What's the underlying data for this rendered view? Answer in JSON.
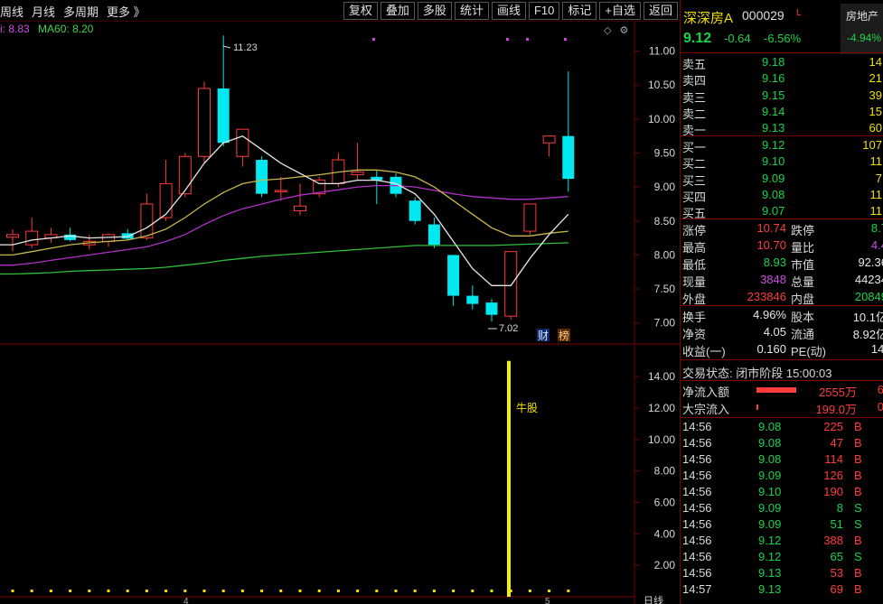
{
  "toolbar": {
    "left_items": [
      "周线",
      "月线",
      "多周期",
      "更多 》"
    ],
    "buttons": [
      "复权",
      "叠加",
      "多股",
      "统计",
      "画线",
      "F10",
      "标记",
      "+自选",
      "返回"
    ]
  },
  "ma_legend": {
    "ma_partial": "i: 8.83",
    "ma60": "MA60: 8.20"
  },
  "chart_labels": {
    "high": "11.23",
    "low": "7.02",
    "badge_cai": "财",
    "badge_bang": "榜",
    "vol_marker": "牛股",
    "x_tick_1": "4",
    "x_tick_2": "5",
    "period_label": "日线"
  },
  "price_axis": [
    "11.00",
    "10.50",
    "10.00",
    "9.50",
    "9.00",
    "8.50",
    "8.00",
    "7.50",
    "7.00"
  ],
  "vol_axis": [
    "14.00",
    "12.00",
    "10.00",
    "8.00",
    "6.00",
    "4.00",
    "2.00"
  ],
  "chart_data": {
    "type": "candlestick",
    "ylim": [
      6.85,
      11.3
    ],
    "candles": [
      {
        "o": 8.26,
        "h": 8.38,
        "l": 8.05,
        "c": 8.3
      },
      {
        "o": 8.15,
        "h": 8.55,
        "l": 8.1,
        "c": 8.35
      },
      {
        "o": 8.25,
        "h": 8.4,
        "l": 8.18,
        "c": 8.3
      },
      {
        "o": 8.3,
        "h": 8.4,
        "l": 8.2,
        "c": 8.22
      },
      {
        "o": 8.15,
        "h": 8.3,
        "l": 8.08,
        "c": 8.2
      },
      {
        "o": 8.2,
        "h": 8.32,
        "l": 8.12,
        "c": 8.3
      },
      {
        "o": 8.32,
        "h": 8.38,
        "l": 8.22,
        "c": 8.24
      },
      {
        "o": 8.25,
        "h": 8.9,
        "l": 8.22,
        "c": 8.75
      },
      {
        "o": 8.55,
        "h": 9.4,
        "l": 8.5,
        "c": 9.05
      },
      {
        "o": 8.9,
        "h": 9.5,
        "l": 8.85,
        "c": 9.45
      },
      {
        "o": 9.45,
        "h": 10.55,
        "l": 9.35,
        "c": 10.45
      },
      {
        "o": 10.45,
        "h": 11.23,
        "l": 9.6,
        "c": 9.65
      },
      {
        "o": 9.45,
        "h": 9.85,
        "l": 9.3,
        "c": 9.85
      },
      {
        "o": 9.4,
        "h": 9.45,
        "l": 8.85,
        "c": 8.9
      },
      {
        "o": 8.95,
        "h": 9.15,
        "l": 8.8,
        "c": 8.95
      },
      {
        "o": 8.65,
        "h": 9.05,
        "l": 8.58,
        "c": 8.72
      },
      {
        "o": 8.9,
        "h": 9.15,
        "l": 8.85,
        "c": 9.1
      },
      {
        "o": 9.05,
        "h": 9.5,
        "l": 9.0,
        "c": 9.4
      },
      {
        "o": 9.18,
        "h": 9.65,
        "l": 9.1,
        "c": 9.22
      },
      {
        "o": 9.15,
        "h": 9.25,
        "l": 8.75,
        "c": 9.1
      },
      {
        "o": 9.15,
        "h": 9.2,
        "l": 8.85,
        "c": 8.9
      },
      {
        "o": 8.8,
        "h": 8.85,
        "l": 8.45,
        "c": 8.5
      },
      {
        "o": 8.45,
        "h": 8.55,
        "l": 8.1,
        "c": 8.15
      },
      {
        "o": 8.0,
        "h": 8.0,
        "l": 7.25,
        "c": 7.4
      },
      {
        "o": 7.4,
        "h": 7.55,
        "l": 7.2,
        "c": 7.28
      },
      {
        "o": 7.3,
        "h": 7.35,
        "l": 7.02,
        "c": 7.12
      },
      {
        "o": 7.1,
        "h": 8.05,
        "l": 7.05,
        "c": 8.05
      },
      {
        "o": 8.35,
        "h": 8.75,
        "l": 8.3,
        "c": 8.75
      },
      {
        "o": 9.65,
        "h": 9.75,
        "l": 9.45,
        "c": 9.75
      },
      {
        "o": 9.75,
        "h": 10.7,
        "l": 8.93,
        "c": 9.12
      }
    ],
    "ma_white": [
      8.15,
      8.22,
      8.25,
      8.28,
      8.25,
      8.26,
      8.27,
      8.4,
      8.6,
      8.95,
      9.35,
      9.65,
      9.75,
      9.55,
      9.35,
      9.2,
      9.05,
      9.05,
      9.1,
      9.1,
      9.05,
      8.9,
      8.6,
      8.2,
      7.8,
      7.55,
      7.55,
      7.95,
      8.3,
      8.6
    ],
    "ma_yellow": [
      8.0,
      8.05,
      8.1,
      8.15,
      8.18,
      8.2,
      8.22,
      8.28,
      8.38,
      8.55,
      8.75,
      8.92,
      9.05,
      9.1,
      9.12,
      9.15,
      9.18,
      9.22,
      9.25,
      9.25,
      9.22,
      9.15,
      9.0,
      8.8,
      8.6,
      8.4,
      8.28,
      8.28,
      8.32,
      8.35
    ],
    "ma_purple": [
      7.85,
      7.88,
      7.92,
      7.96,
      8.0,
      8.04,
      8.08,
      8.12,
      8.2,
      8.3,
      8.45,
      8.58,
      8.68,
      8.75,
      8.82,
      8.88,
      8.92,
      8.96,
      9.0,
      9.02,
      9.02,
      9.0,
      8.95,
      8.9,
      8.86,
      8.84,
      8.82,
      8.82,
      8.84,
      8.86
    ],
    "ma_green": [
      7.72,
      7.73,
      7.74,
      7.76,
      7.77,
      7.78,
      7.79,
      7.8,
      7.82,
      7.85,
      7.88,
      7.92,
      7.95,
      7.98,
      8.0,
      8.02,
      8.04,
      8.06,
      8.08,
      8.1,
      8.12,
      8.14,
      8.14,
      8.14,
      8.14,
      8.14,
      8.15,
      8.16,
      8.17,
      8.18
    ],
    "volume_spike_value": 15.0,
    "vol_ylim": [
      0,
      15.5
    ]
  },
  "quote": {
    "name": "深深房A",
    "code": "000029",
    "flag": "L",
    "sector": "房地产",
    "sector_change": "-4.94%",
    "price": "9.12",
    "change": "-0.64",
    "change_pct": "-6.56%"
  },
  "asks": [
    {
      "label": "卖五",
      "price": "9.18",
      "vol": "14"
    },
    {
      "label": "卖四",
      "price": "9.16",
      "vol": "21"
    },
    {
      "label": "卖三",
      "price": "9.15",
      "vol": "39"
    },
    {
      "label": "卖二",
      "price": "9.14",
      "vol": "15"
    },
    {
      "label": "卖一",
      "price": "9.13",
      "vol": "60"
    }
  ],
  "bids": [
    {
      "label": "买一",
      "price": "9.12",
      "vol": "107"
    },
    {
      "label": "买二",
      "price": "9.10",
      "vol": "11"
    },
    {
      "label": "买三",
      "price": "9.09",
      "vol": "7"
    },
    {
      "label": "买四",
      "price": "9.08",
      "vol": "11"
    },
    {
      "label": "买五",
      "price": "9.07",
      "vol": "11"
    }
  ],
  "stats": [
    {
      "l1": "涨停",
      "v1": "10.74",
      "c1": "red",
      "l2": "跌停",
      "v2": "8.7",
      "c2": "green"
    },
    {
      "l1": "最高",
      "v1": "10.70",
      "c1": "red",
      "l2": "量比",
      "v2": "4.4",
      "c2": "purple"
    },
    {
      "l1": "最低",
      "v1": "8.93",
      "c1": "green",
      "l2": "市值",
      "v2": "92.36",
      "c2": "white"
    },
    {
      "l1": "现量",
      "v1": "3848",
      "c1": "purple",
      "l2": "总量",
      "v2": "44234",
      "c2": "white"
    },
    {
      "l1": "外盘",
      "v1": "233846",
      "c1": "red",
      "l2": "内盘",
      "v2": "20849",
      "c2": "green"
    }
  ],
  "stats2": [
    {
      "l1": "换手",
      "v1": "4.96%",
      "l2": "股本",
      "v2": "10.1亿"
    },
    {
      "l1": "净资",
      "v1": "4.05",
      "l2": "流通",
      "v2": "8.92亿"
    },
    {
      "l1": "收益(一)",
      "v1": "0.160",
      "l2": "PE(动)",
      "v2": "14."
    }
  ],
  "trade_status": "交易状态: 闭市阶段 15:00:03",
  "flows": [
    {
      "label": "净流入额",
      "value": "2555万",
      "pct": "6"
    },
    {
      "label": "大宗流入",
      "value": "199.0万",
      "pct": "0"
    }
  ],
  "ticks": [
    {
      "time": "14:56",
      "price": "9.08",
      "vol": "225",
      "side": "B"
    },
    {
      "time": "14:56",
      "price": "9.08",
      "vol": "47",
      "side": "B"
    },
    {
      "time": "14:56",
      "price": "9.08",
      "vol": "114",
      "side": "B"
    },
    {
      "time": "14:56",
      "price": "9.09",
      "vol": "126",
      "side": "B"
    },
    {
      "time": "14:56",
      "price": "9.10",
      "vol": "190",
      "side": "B"
    },
    {
      "time": "14:56",
      "price": "9.09",
      "vol": "8",
      "side": "S"
    },
    {
      "time": "14:56",
      "price": "9.09",
      "vol": "51",
      "side": "S"
    },
    {
      "time": "14:56",
      "price": "9.12",
      "vol": "388",
      "side": "B"
    },
    {
      "time": "14:56",
      "price": "9.12",
      "vol": "65",
      "side": "S"
    },
    {
      "time": "14:56",
      "price": "9.13",
      "vol": "53",
      "side": "B"
    },
    {
      "time": "14:57",
      "price": "9.13",
      "vol": "69",
      "side": "B"
    }
  ],
  "colors": {
    "up": "#ff3b3b",
    "down": "#00e8f0",
    "bg": "#000000",
    "grid_red": "#7a0000"
  }
}
